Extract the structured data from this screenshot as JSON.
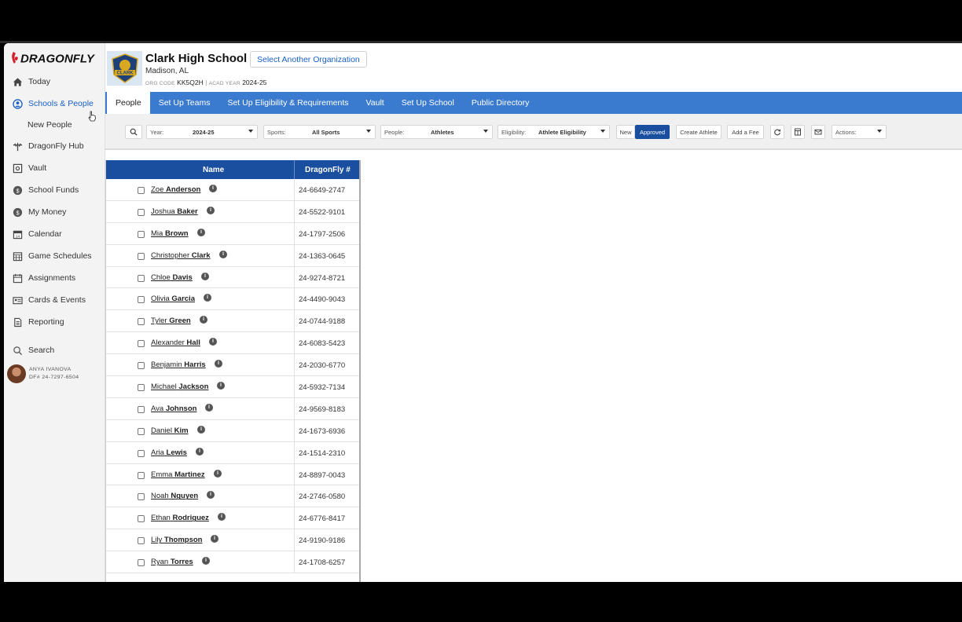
{
  "sidebar": {
    "brand": "DRAGONFLY",
    "items": [
      {
        "label": "Today",
        "icon": "home-icon"
      },
      {
        "label": "Schools & People",
        "icon": "person-icon"
      },
      {
        "label": "DragonFly Hub",
        "icon": "hub-icon"
      },
      {
        "label": "Vault",
        "icon": "vault-icon"
      },
      {
        "label": "School Funds",
        "icon": "coin-icon"
      },
      {
        "label": "My Money",
        "icon": "coin-icon"
      },
      {
        "label": "Calendar",
        "icon": "calendar-icon"
      },
      {
        "label": "Game Schedules",
        "icon": "schedule-icon"
      },
      {
        "label": "Assignments",
        "icon": "assignments-icon"
      },
      {
        "label": "Cards & Events",
        "icon": "card-icon"
      },
      {
        "label": "Reporting",
        "icon": "document-icon"
      }
    ],
    "sub_item": "New People",
    "search": "Search",
    "user": {
      "name": "ANYA IVANOVA",
      "df": "DF# 24-7297-6504"
    }
  },
  "org": {
    "name": "Clark High School",
    "logo_text": "CLARK",
    "select_label": "Select Another Organization",
    "location": "Madison, AL",
    "code_label": "ORG CODE",
    "code": "KK5Q2H",
    "year_label": "ACAD YEAR",
    "year": "2024-25"
  },
  "tabs": [
    "People",
    "Set Up Teams",
    "Set Up Eligibility & Requirements",
    "Vault",
    "Set Up School",
    "Public Directory"
  ],
  "filters": {
    "year_label": "Year:",
    "year_value": "2024-25",
    "sports_label": "Sports:",
    "sports_value": "All Sports",
    "people_label": "People:",
    "people_value": "Athletes",
    "elig_label": "Eligibility:",
    "elig_value": "Athlete Eligibility",
    "new_label": "New",
    "approved_label": "Approved",
    "create_label": "Create Athlete",
    "fee_label": "Add a Fee",
    "actions_label": "Actions:"
  },
  "table": {
    "col_name": "Name",
    "col_df": "DragonFly #",
    "rows": [
      {
        "first": "Zoe",
        "last": "Anderson",
        "df": "24-6649-2747"
      },
      {
        "first": "Joshua",
        "last": "Baker",
        "df": "24-5522-9101"
      },
      {
        "first": "Mia",
        "last": "Brown",
        "df": "24-1797-2506"
      },
      {
        "first": "Christopher",
        "last": "Clark",
        "df": "24-1363-0645"
      },
      {
        "first": "Chloe",
        "last": "Davis",
        "df": "24-9274-8721"
      },
      {
        "first": "Olivia",
        "last": "Garcia",
        "df": "24-4490-9043"
      },
      {
        "first": "Tyler",
        "last": "Green",
        "df": "24-0744-9188"
      },
      {
        "first": "Alexander",
        "last": "Hall",
        "df": "24-6083-5423"
      },
      {
        "first": "Benjamin",
        "last": "Harris",
        "df": "24-2030-6770"
      },
      {
        "first": "Michael",
        "last": "Jackson",
        "df": "24-5932-7134"
      },
      {
        "first": "Ava",
        "last": "Johnson",
        "df": "24-9569-8183"
      },
      {
        "first": "Daniel",
        "last": "Kim",
        "df": "24-1673-6936"
      },
      {
        "first": "Aria",
        "last": "Lewis",
        "df": "24-1514-2310"
      },
      {
        "first": "Emma",
        "last": "Martinez",
        "df": "24-8897-0043"
      },
      {
        "first": "Noah",
        "last": "Nguyen",
        "df": "24-2746-0580"
      },
      {
        "first": "Ethan",
        "last": "Rodriguez",
        "df": "24-6776-8417"
      },
      {
        "first": "Lily",
        "last": "Thompson",
        "df": "24-9190-9186"
      },
      {
        "first": "Ryan",
        "last": "Torres",
        "df": "24-1708-6257"
      }
    ]
  },
  "colors": {
    "accent": "#3a7bcf",
    "header": "#1a4fa0",
    "active": "#1a5fc4"
  }
}
